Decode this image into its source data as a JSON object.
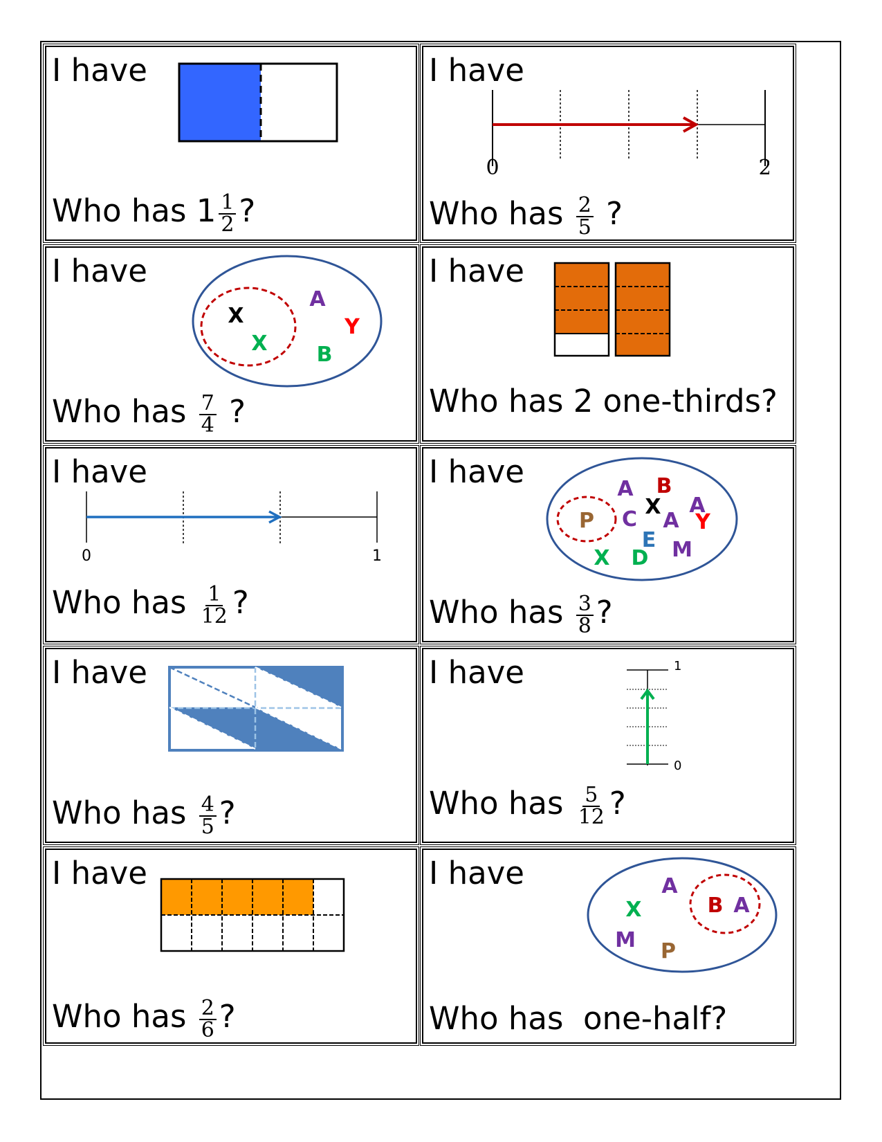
{
  "i_have": "I have",
  "who_has": "Who has",
  "cards": [
    {
      "who_prefix": "Who has 1",
      "num": "1",
      "den": "2",
      "suffix": "?"
    },
    {
      "who_prefix": "Who has ",
      "num": "2",
      "den": "5",
      "suffix": " ?",
      "labels": [
        "0",
        "2"
      ]
    },
    {
      "who_prefix": "Who has ",
      "num": "7",
      "den": "4",
      "suffix": " ?",
      "letters": [
        "X",
        "X",
        "A",
        "Y",
        "B"
      ]
    },
    {
      "text": "Who has 2 one-thirds?"
    },
    {
      "who_prefix": "Who has ",
      "num": "1",
      "den": "12",
      "suffix": "?",
      "labels": [
        "0",
        "1"
      ]
    },
    {
      "who_prefix": "Who has ",
      "num": "3",
      "den": "8",
      "suffix": "?",
      "letters": [
        "P",
        "A",
        "B",
        "X",
        "A",
        "C",
        "A",
        "Y",
        "E",
        "M",
        "X",
        "D"
      ]
    },
    {
      "who_prefix": "Who has ",
      "num": "4",
      "den": "5",
      "suffix": "?"
    },
    {
      "who_prefix": "Who has ",
      "num": "5",
      "den": "12",
      "suffix": "?",
      "labels": [
        "1",
        "0"
      ]
    },
    {
      "who_prefix": "Who has ",
      "num": "2",
      "den": "6",
      "suffix": "?"
    },
    {
      "text": "Who has  one-half?",
      "letters": [
        "A",
        "X",
        "B",
        "A",
        "M",
        "P"
      ]
    }
  ],
  "colors": {
    "blue": "#3366ff",
    "orange_dark": "#e36c0a",
    "orange": "#ff9900",
    "red_arrow": "#c00000",
    "blue_arrow": "#1f6fbf",
    "green": "#00b050",
    "purple": "#7030a0",
    "red": "#ff0000",
    "dark_red": "#c00000",
    "brown": "#996633",
    "ellipse": "#2f5597",
    "shade": "#4f81bd"
  }
}
